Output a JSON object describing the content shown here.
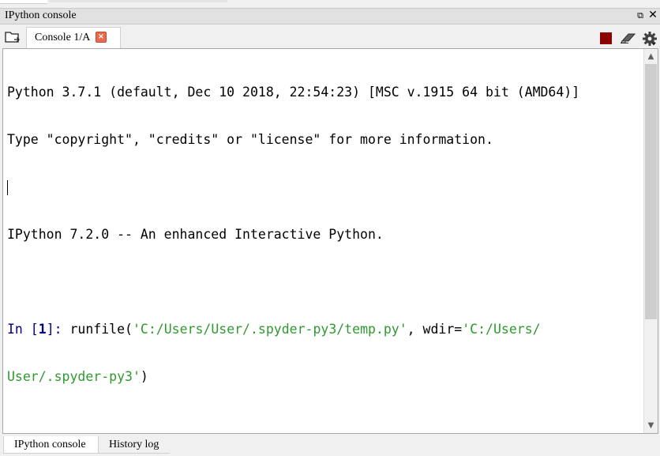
{
  "pane": {
    "title": "IPython console",
    "undock_glyph": "⧉",
    "close_glyph": "✕"
  },
  "tabs": [
    {
      "label": "Console 1/A",
      "close_glyph": "×"
    }
  ],
  "toolbar": {
    "icons": [
      "browse-tabs-icon",
      "stop-icon",
      "eraser-icon",
      "gear-icon"
    ],
    "stop_color": "#8b0000"
  },
  "console": {
    "lines": [
      "Python 3.7.1 (default, Dec 10 2018, 22:54:23) [MSC v.1915 64 bit (AMD64)]",
      "Type \"copyright\", \"credits\" or \"license\" for more information.",
      "",
      "IPython 7.2.0 -- An enhanced Interactive Python.",
      ""
    ],
    "prompt": {
      "in_label": "In [",
      "number": "1",
      "close": "]: ",
      "code_prefix": "runfile(",
      "string1": "'C:/Users/User/.spyder-py3/temp.py'",
      "mid": ", wdir=",
      "string2_part1": "'C:/Users/",
      "string2_part2": "User/.spyder-py3'",
      "code_suffix": ")"
    },
    "string_color": "#2e9a2e",
    "prompt_color": "#000080"
  },
  "scrollbar": {
    "up_glyph": "▲",
    "down_glyph": "▼"
  },
  "bottom_tabs": [
    {
      "label": "IPython console",
      "active": true
    },
    {
      "label": "History log",
      "active": false
    }
  ]
}
